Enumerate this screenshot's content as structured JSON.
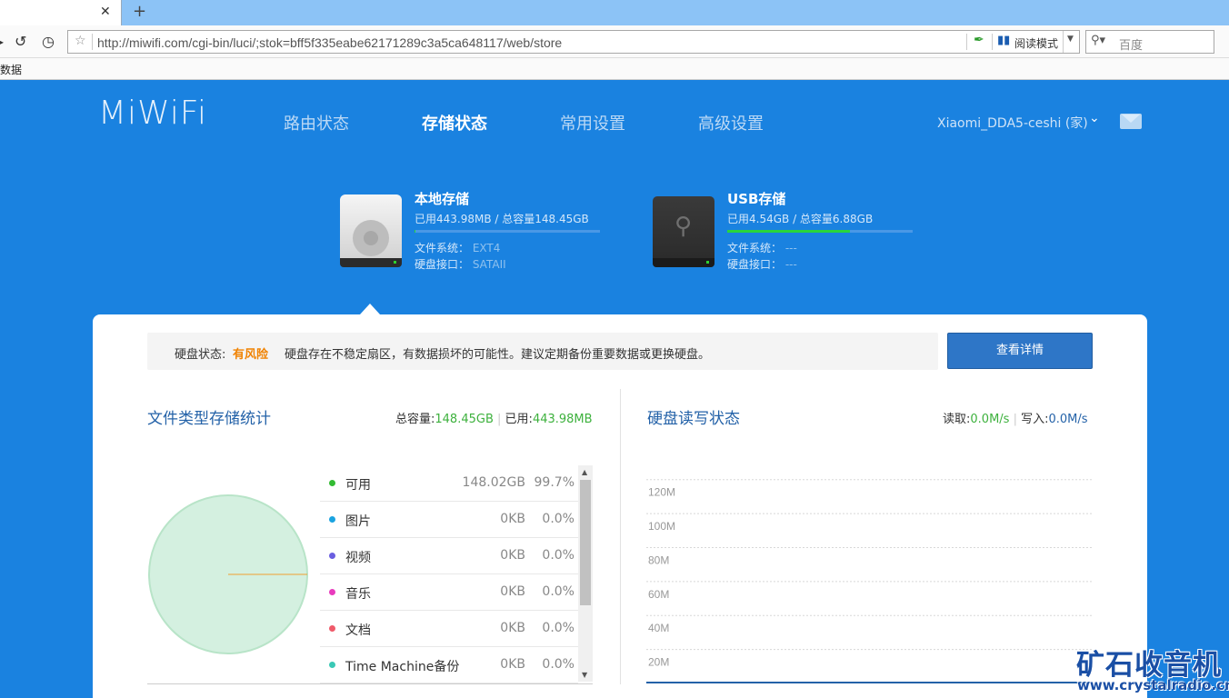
{
  "browser": {
    "url": "http://miwifi.com/cgi-bin/luci/;stok=bff5f335eabe62171289c3a5ca648117/web/store",
    "read_mode_label": "阅读模式",
    "search_placeholder": "百度",
    "bookmark_label": "数据"
  },
  "header": {
    "logo": "MiWiFi",
    "nav": [
      "路由状态",
      "存储状态",
      "常用设置",
      "高级设置"
    ],
    "active_nav": "存储状态",
    "router_name": "Xiaomi_DDA5-ceshi (家)"
  },
  "storage": {
    "local": {
      "title": "本地存储",
      "usage": "已用443.98MB / 总容量148.45GB",
      "used_fraction": 0.003,
      "fs_label": "文件系统：",
      "fs_value": "EXT4",
      "iface_label": "硬盘接口：",
      "iface_value": "SATAII"
    },
    "usb": {
      "title": "USB存储",
      "usage": "已用4.54GB / 总容量6.88GB",
      "used_fraction": 0.66,
      "fs_label": "文件系统：",
      "fs_value": "---",
      "iface_label": "硬盘接口：",
      "iface_value": "---"
    }
  },
  "notice": {
    "label": "硬盘状态:",
    "status": "有风险",
    "message": "硬盘存在不稳定扇区，有数据损坏的可能性。建议定期备份重要数据或更换硬盘。",
    "button": "查看详情"
  },
  "file_stats": {
    "title": "文件类型存储统计",
    "total_label": "总容量:",
    "total_value": "148.45GB",
    "used_label": "已用:",
    "used_value": "443.98MB",
    "separator": "|",
    "items": [
      {
        "name": "可用",
        "size": "148.02GB",
        "pct": "99.7%",
        "color": "#33bb33"
      },
      {
        "name": "图片",
        "size": "0KB",
        "pct": "0.0%",
        "color": "#1aa3e0"
      },
      {
        "name": "视频",
        "size": "0KB",
        "pct": "0.0%",
        "color": "#6a5ee0"
      },
      {
        "name": "音乐",
        "size": "0KB",
        "pct": "0.0%",
        "color": "#e83bbd"
      },
      {
        "name": "文档",
        "size": "0KB",
        "pct": "0.0%",
        "color": "#ef5a6a"
      },
      {
        "name": "Time Machine备份",
        "size": "0KB",
        "pct": "0.0%",
        "color": "#3ac8b5"
      }
    ],
    "pie": {
      "available_fraction": 0.997,
      "available_color": "#d4f0e0",
      "used_color": "#f0a030"
    }
  },
  "io": {
    "title": "硬盘读写状态",
    "read_label": "读取:",
    "read_value": "0.0M/s",
    "write_label": "写入:",
    "write_value": "0.0M/s",
    "separator": "|"
  },
  "chart_data": {
    "type": "line",
    "title": "",
    "xlabel": "",
    "ylabel": "",
    "y_ticks": [
      "120M",
      "100M",
      "80M",
      "60M",
      "40M",
      "20M"
    ],
    "ylim": [
      0,
      130
    ],
    "series": [
      {
        "values": [
          0,
          0,
          0,
          0,
          0,
          0,
          0,
          0,
          0,
          0
        ]
      }
    ],
    "grid": true
  },
  "watermark": {
    "text": "矿石收音机",
    "url": "www.crystalradio.cn"
  }
}
